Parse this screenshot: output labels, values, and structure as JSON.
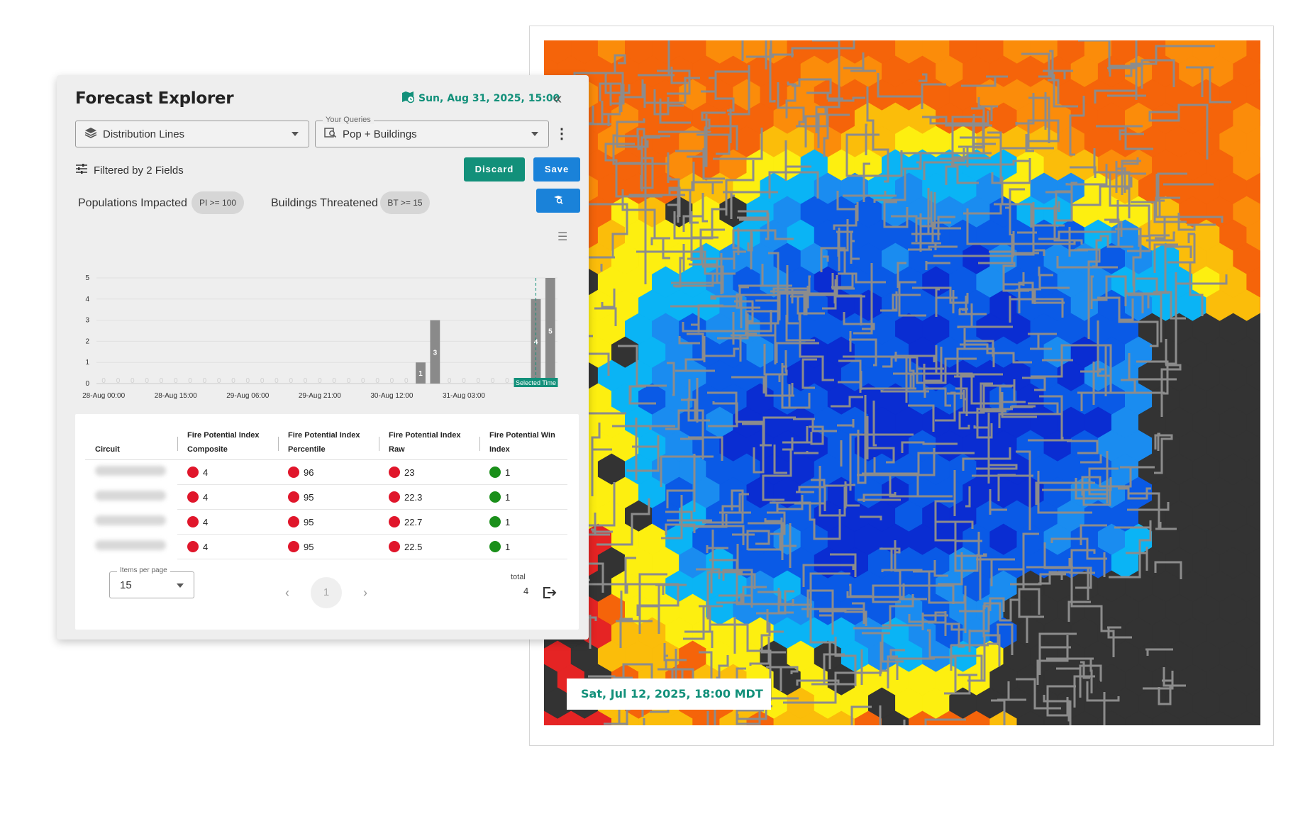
{
  "panel": {
    "title": "Forecast Explorer",
    "forecast_date": "Sun, Aug 31, 2025, 15:00",
    "layer_select": {
      "value": "Distribution Lines"
    },
    "query_select": {
      "legend": "Your Queries",
      "value": "Pop + Buildings"
    },
    "filtered_label": "Filtered by 2 Fields",
    "buttons": {
      "discard": "Discard",
      "save": "Save"
    },
    "filters": [
      {
        "label": "Populations Impacted",
        "chip": "PI >= 100"
      },
      {
        "label": "Buildings Threatened",
        "chip": "BT >= 15"
      }
    ]
  },
  "chart_data": {
    "type": "bar",
    "title": "",
    "xlabel": "",
    "ylabel": "",
    "ylim": [
      0,
      5
    ],
    "y_ticks": [
      0,
      1,
      2,
      3,
      4,
      5
    ],
    "x_tick_labels": [
      "28-Aug 00:00",
      "28-Aug 15:00",
      "29-Aug 06:00",
      "29-Aug 21:00",
      "30-Aug 12:00",
      "31-Aug 03:00"
    ],
    "values": [
      0,
      0,
      0,
      0,
      0,
      0,
      0,
      0,
      0,
      0,
      0,
      0,
      0,
      0,
      0,
      0,
      0,
      0,
      0,
      0,
      0,
      0,
      1,
      3,
      0,
      0,
      0,
      0,
      0,
      0,
      4,
      5
    ],
    "zero_label": "0",
    "selected_marker_label": "Selected Time",
    "selected_index": 30,
    "grid": true
  },
  "table": {
    "columns": [
      {
        "line1": "Circuit",
        "line2": ""
      },
      {
        "line1": "Fire Potential Index",
        "line2": "Composite"
      },
      {
        "line1": "Fire Potential Index",
        "line2": "Percentile"
      },
      {
        "line1": "Fire Potential Index",
        "line2": "Raw"
      },
      {
        "line1": "Fire Potential Win",
        "line2": "Index"
      }
    ],
    "rows": [
      {
        "composite": "4",
        "percentile": "96",
        "raw": "23",
        "wind": "1"
      },
      {
        "composite": "4",
        "percentile": "95",
        "raw": "22.3",
        "wind": "1"
      },
      {
        "composite": "4",
        "percentile": "95",
        "raw": "22.7",
        "wind": "1"
      },
      {
        "composite": "4",
        "percentile": "95",
        "raw": "22.5",
        "wind": "1"
      }
    ],
    "status_colors": {
      "high": "#e0162b",
      "low": "#1a8f1a"
    },
    "items_per_page_legend": "Items per page",
    "items_per_page": "15",
    "current_page": "1",
    "total_label": "total",
    "total": "4"
  },
  "map": {
    "timestamp": "Sat, Jul 12, 2025, 18:00 MDT"
  },
  "colors": {
    "accent_green": "#12907a",
    "accent_blue": "#1a82d9",
    "map_background": "#333333"
  }
}
